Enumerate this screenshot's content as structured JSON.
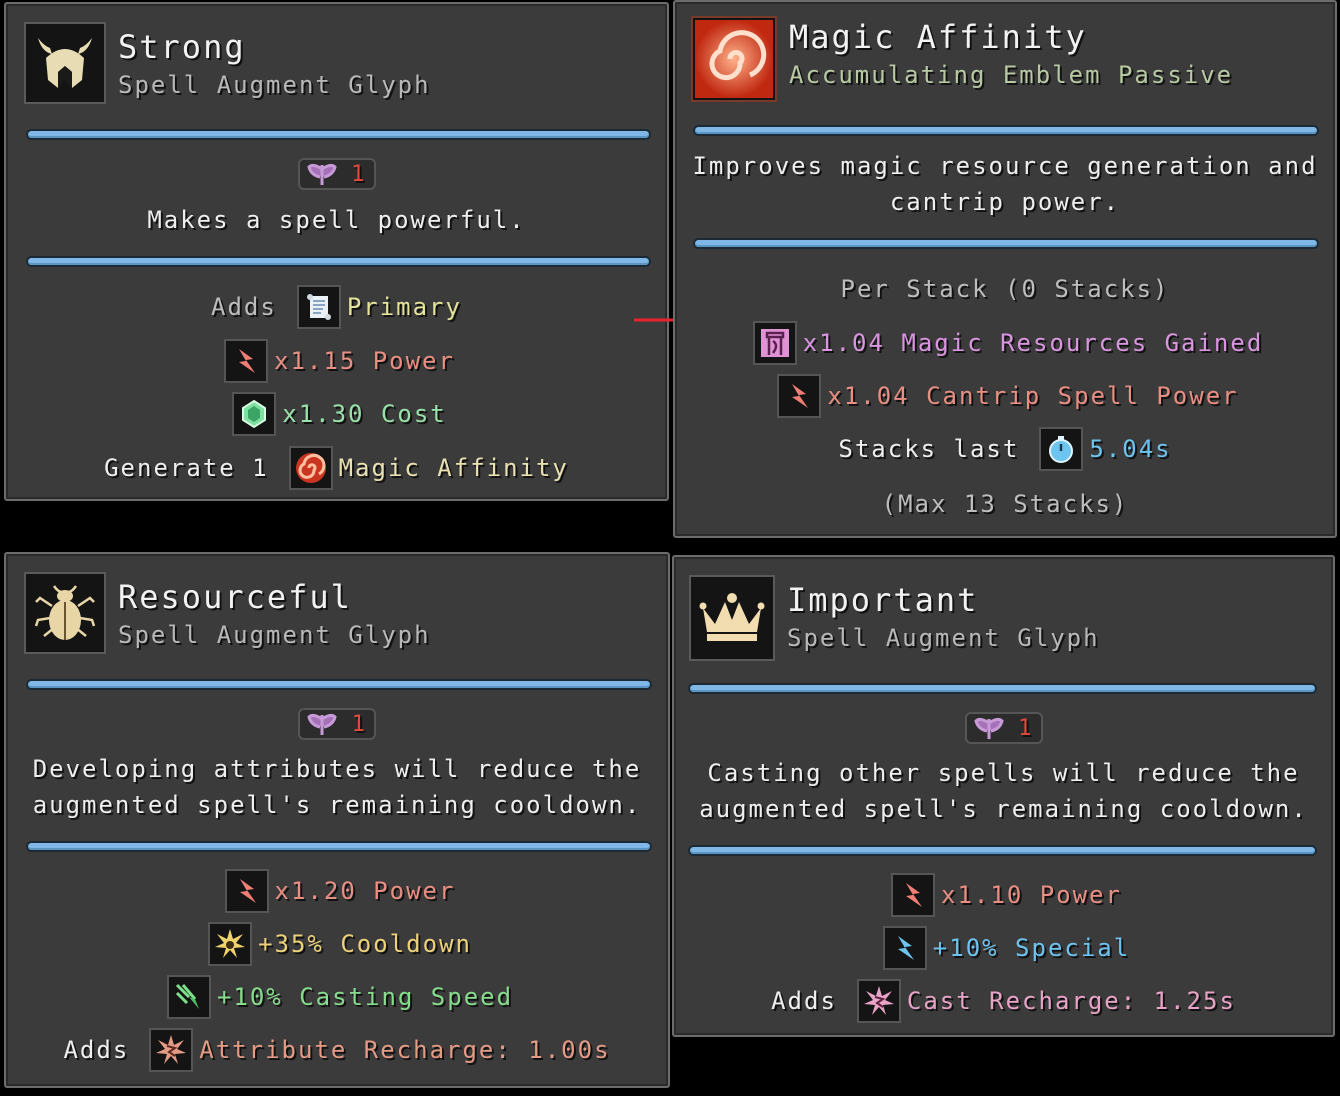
{
  "strong": {
    "title": "Strong",
    "subtitle": "Spell Augment Glyph",
    "icon": "horned-helmet-icon",
    "badge": "1",
    "description": "Makes a spell powerful.",
    "adds_label": "Adds",
    "adds_value": "Primary",
    "power": "x1.15 Power",
    "cost": "x1.30 Cost",
    "generate_label": "Generate 1",
    "generate_value": "Magic Affinity"
  },
  "magic_affinity": {
    "title": "Magic Affinity",
    "subtitle": "Accumulating Emblem Passive",
    "icon": "red-swirl-icon",
    "description_line1": "Improves magic resource generation and",
    "description_line2": "cantrip power.",
    "per_stack": "Per Stack (0 Stacks)",
    "resources": "x1.04 Magic Resources Gained",
    "cantrip": "x1.04 Cantrip Spell Power",
    "stacks_last_label": "Stacks last",
    "stacks_last_value": "5.04s",
    "max_stacks": "(Max 13 Stacks)"
  },
  "resourceful": {
    "title": "Resourceful",
    "subtitle": "Spell Augment Glyph",
    "icon": "scarab-icon",
    "badge": "1",
    "description_line1": "Developing attributes will reduce the",
    "description_line2": "augmented spell's remaining cooldown.",
    "power": "x1.20 Power",
    "cooldown": "+35% Cooldown",
    "casting_speed": "+10% Casting Speed",
    "adds_label": "Adds",
    "adds_value": "Attribute Recharge: 1.00s"
  },
  "important": {
    "title": "Important",
    "subtitle": "Spell Augment Glyph",
    "icon": "crown-icon",
    "badge": "1",
    "description_line1": "Casting other spells will reduce the",
    "description_line2": "augmented spell's remaining cooldown.",
    "power": "x1.10 Power",
    "special": "+10% Special",
    "adds_label": "Adds",
    "adds_value": "Cast Recharge: 1.25s"
  }
}
